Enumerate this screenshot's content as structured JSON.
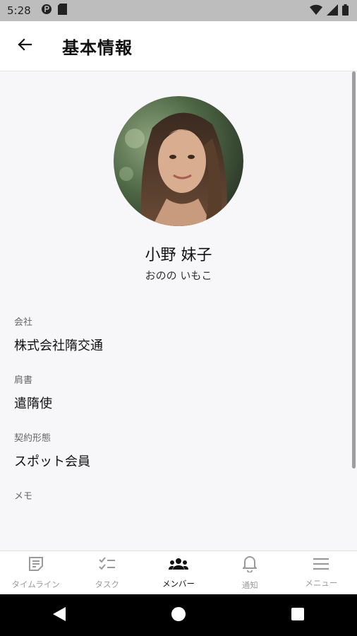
{
  "status_bar": {
    "time": "5:28",
    "icons": [
      "app-notification-icon",
      "sd-card-icon",
      "wifi-icon",
      "cellular-signal-icon",
      "battery-icon"
    ]
  },
  "header": {
    "title": "基本情報",
    "back_icon": "arrow-left-icon"
  },
  "profile": {
    "name": "小野 妹子",
    "kana": "おのの いもこ"
  },
  "fields": [
    {
      "label": "会社",
      "value": "株式会社隋交通"
    },
    {
      "label": "肩書",
      "value": "遣隋使"
    },
    {
      "label": "契約形態",
      "value": "スポット会員"
    },
    {
      "label": "メモ",
      "value": ""
    }
  ],
  "bottom_nav": {
    "items": [
      {
        "label": "タイムライン",
        "icon": "note-icon",
        "active": false
      },
      {
        "label": "タスク",
        "icon": "checklist-icon",
        "active": false
      },
      {
        "label": "メンバー",
        "icon": "group-icon",
        "active": true
      },
      {
        "label": "通知",
        "icon": "bell-icon",
        "active": false
      },
      {
        "label": "メニュー",
        "icon": "menu-icon",
        "active": false
      }
    ]
  },
  "colors": {
    "status_bar_bg": "#bdbdbd",
    "page_bg": "#f7f7f9",
    "active_nav": "#111111",
    "inactive_nav": "#9a9a9a"
  }
}
